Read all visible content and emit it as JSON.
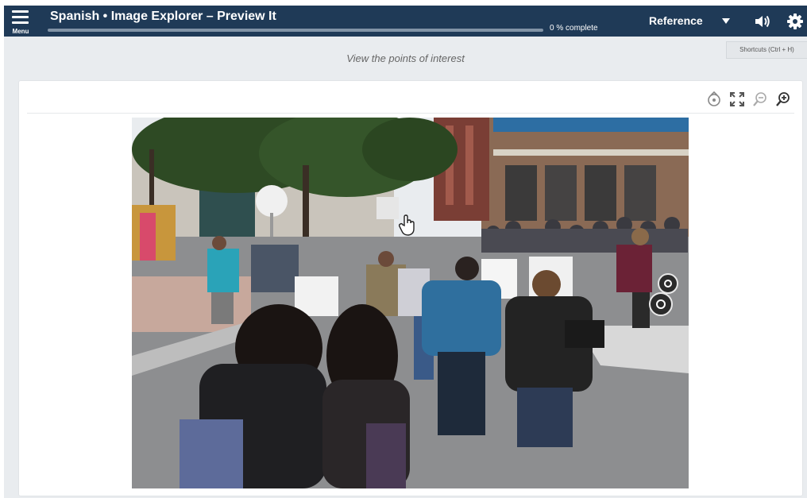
{
  "header": {
    "menu_label": "Menu",
    "title": "Spanish • Image Explorer – Preview It",
    "progress_percent": 0,
    "progress_text": "0 % complete",
    "reference_label": "Reference",
    "icons": [
      "menu-icon",
      "chevron-down-icon",
      "speaker-icon",
      "gear-icon"
    ]
  },
  "shortcuts_label": "Shortcuts (Ctrl + H)",
  "instruction": "View the points of interest",
  "toolbar": {
    "icons": [
      "reset-icon",
      "fullscreen-icon",
      "zoom-out-icon",
      "zoom-in-icon"
    ]
  },
  "image": {
    "hotspot_count": 2
  },
  "colors": {
    "header_bg": "#1f3a57",
    "page_bg": "#e9ecef",
    "card_bg": "#ffffff",
    "hotspot": "#2b2b2b"
  }
}
